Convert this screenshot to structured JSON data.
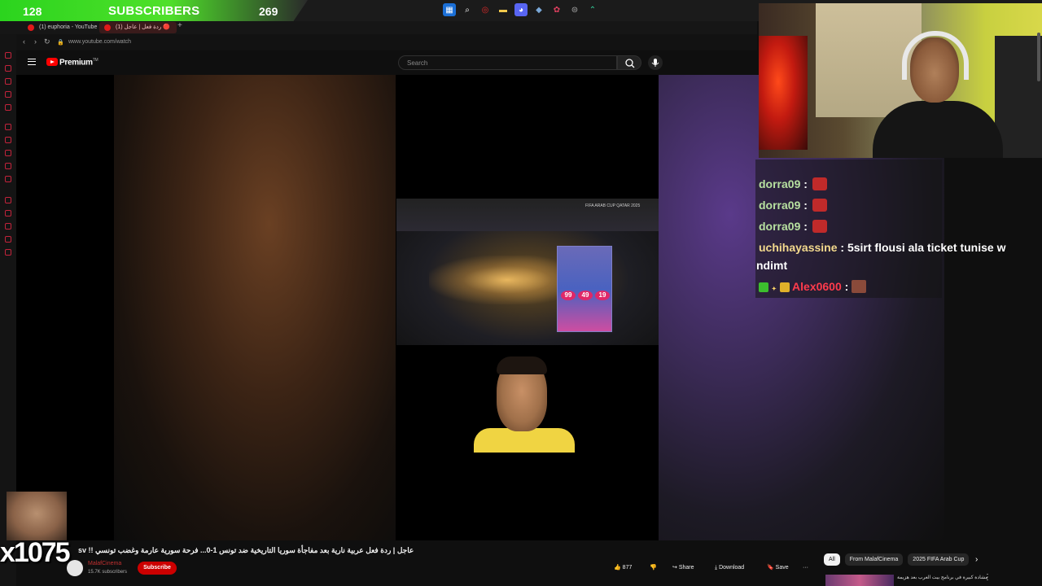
{
  "overlay": {
    "sub_count_left": "128",
    "sub_label": "SUBSCRIBERS",
    "sub_count_right": "269",
    "counter": "x1075"
  },
  "taskbar": {
    "icons": [
      "windows-start-icon",
      "search-icon",
      "opera-icon",
      "folder-icon",
      "discord-icon",
      "steam-icon",
      "app-icon",
      "app-icon-2",
      "chevron-icon"
    ]
  },
  "browser": {
    "tabs": [
      {
        "label": "(1) euphoria - YouTube"
      },
      {
        "label": "(1) ردة فعل | عاجل 🔴"
      }
    ],
    "new_tab": "+",
    "url": "www.youtube.com/watch"
  },
  "youtube": {
    "brand": "Premium",
    "search_placeholder": "Search"
  },
  "video": {
    "stadium_badge": "FIFA ARAB CUP QATAR 2025",
    "poster_numbers": [
      "99",
      "49",
      "19"
    ]
  },
  "chat": {
    "messages": [
      {
        "user": "dorra09",
        "text": ""
      },
      {
        "user": "dorra09",
        "text": ""
      },
      {
        "user": "dorra09",
        "text": ""
      },
      {
        "user": "uchihayassine",
        "text": "5sirt flousi ala ticket tunise w",
        "text2": "ndimt"
      },
      {
        "user": "Alex0600",
        "text": ""
      }
    ]
  },
  "below_video": {
    "title": "عاجل | ردة فعل عربية نارية بعد مفاجأة سوريا التاريخية ضد تونس 1-0... فرحة سورية عارمة وغضب تونسي !! sv",
    "channel_name": "MalafCinema",
    "channel_subs": "15.7K subscribers",
    "subscribe": "Subscribe",
    "likes": "877",
    "share": "Share",
    "download": "Download",
    "save": "Save",
    "more": "···"
  },
  "chips": [
    "All",
    "From MalafCinema",
    "2025 FIFA Arab Cup"
  ],
  "recommendation": {
    "title": "مشادة كبيرة في برنامج بيت العرب بعد هزيمة"
  }
}
